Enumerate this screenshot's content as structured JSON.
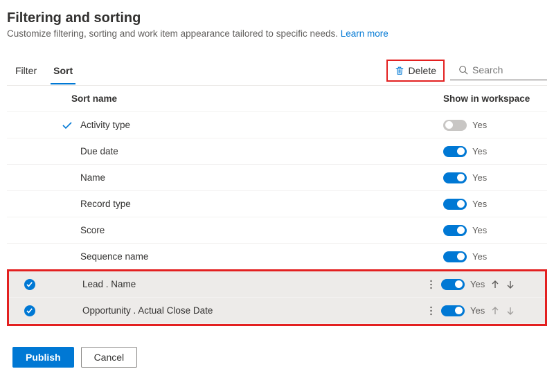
{
  "header": {
    "title": "Filtering and sorting",
    "subtitle_prefix": "Customize filtering, sorting and work item appearance tailored to specific needs. ",
    "learn_more": "Learn more"
  },
  "tabs": {
    "filter": "Filter",
    "sort": "Sort"
  },
  "toolbar": {
    "delete": "Delete",
    "search_placeholder": "Search"
  },
  "columns": {
    "sort_name": "Sort name",
    "show_in_workspace": "Show in workspace"
  },
  "rows": [
    {
      "name": "Activity type",
      "toggle_on": false,
      "toggle_label": "Yes",
      "checked": true
    },
    {
      "name": "Due date",
      "toggle_on": true,
      "toggle_label": "Yes",
      "checked": false
    },
    {
      "name": "Name",
      "toggle_on": true,
      "toggle_label": "Yes",
      "checked": false
    },
    {
      "name": "Record type",
      "toggle_on": true,
      "toggle_label": "Yes",
      "checked": false
    },
    {
      "name": "Score",
      "toggle_on": true,
      "toggle_label": "Yes",
      "checked": false
    },
    {
      "name": "Sequence name",
      "toggle_on": true,
      "toggle_label": "Yes",
      "checked": false
    }
  ],
  "selected_rows": [
    {
      "name": "Lead . Name",
      "toggle_on": true,
      "toggle_label": "Yes"
    },
    {
      "name": "Opportunity . Actual Close Date",
      "toggle_on": true,
      "toggle_label": "Yes"
    }
  ],
  "footer": {
    "publish": "Publish",
    "cancel": "Cancel"
  }
}
